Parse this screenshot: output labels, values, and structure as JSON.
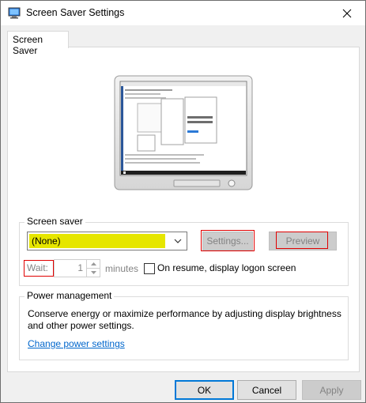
{
  "window": {
    "title": "Screen Saver Settings",
    "icon": "screen-saver-app-icon",
    "close_icon": "close-icon"
  },
  "tabs": [
    {
      "label": "Screen Saver",
      "selected": true
    }
  ],
  "screen_saver": {
    "group_label": "Screen saver",
    "selected": "(None)",
    "highlight_color": "#e6e600",
    "settings_label": "Settings...",
    "preview_label": "Preview",
    "wait_label": "Wait:",
    "wait_value": "1",
    "minutes_label": "minutes",
    "logon_checkbox_label": "On resume, display logon screen",
    "logon_checked": false
  },
  "power": {
    "group_label": "Power management",
    "description": "Conserve energy or maximize performance by adjusting display brightness and other power settings.",
    "link_label": "Change power settings"
  },
  "footer": {
    "ok_label": "OK",
    "cancel_label": "Cancel",
    "apply_label": "Apply"
  },
  "annotation_color": "#e00000"
}
